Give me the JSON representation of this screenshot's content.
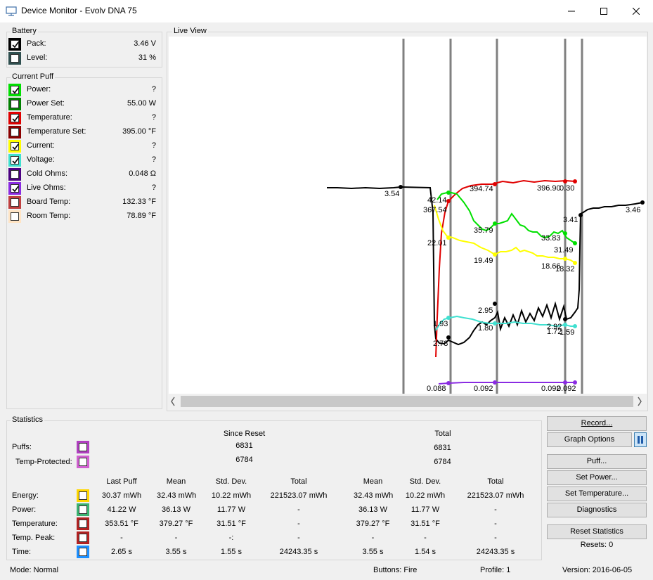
{
  "window": {
    "title": "Device Monitor - Evolv DNA 75",
    "minimize_icon": "minimize-icon",
    "maximize_icon": "maximize-icon",
    "close_icon": "close-icon"
  },
  "battery": {
    "label": "Battery",
    "rows": [
      {
        "name": "Pack:",
        "value": "3.46 V",
        "color": "#000000",
        "checked": true
      },
      {
        "name": "Level:",
        "value": "31 %",
        "color": "#2f4f4f",
        "checked": false
      }
    ]
  },
  "current_puff": {
    "label": "Current Puff",
    "rows": [
      {
        "name": "Power:",
        "value": "?",
        "color": "#00e000",
        "checked": true
      },
      {
        "name": "Power Set:",
        "value": "55.00 W",
        "color": "#008000",
        "checked": false
      },
      {
        "name": "Temperature:",
        "value": "?",
        "color": "#e00000",
        "checked": true
      },
      {
        "name": "Temperature Set:",
        "value": "395.00 °F",
        "color": "#8b0000",
        "checked": false
      },
      {
        "name": "Current:",
        "value": "?",
        "color": "#ffff00",
        "checked": true
      },
      {
        "name": "Voltage:",
        "value": "?",
        "color": "#40e0d0",
        "checked": true
      },
      {
        "name": "Cold Ohms:",
        "value": "0.048 Ω",
        "color": "#4b0082",
        "checked": false
      },
      {
        "name": "Live Ohms:",
        "value": "?",
        "color": "#8a2be2",
        "checked": true
      },
      {
        "name": "Board Temp:",
        "value": "132.33 °F",
        "color": "#c04040",
        "checked": false
      },
      {
        "name": "Room Temp:",
        "value": "78.89 °F",
        "color": "#ffe4c4",
        "checked": false
      }
    ]
  },
  "live_view": {
    "label": "Live View",
    "annotations": [
      {
        "text": "3.54"
      },
      {
        "text": "3.46"
      },
      {
        "text": "3.41"
      },
      {
        "text": "42.14"
      },
      {
        "text": "367.54"
      },
      {
        "text": "394.74"
      },
      {
        "text": "396.90"
      },
      {
        "text": "0.30"
      },
      {
        "text": "22.01"
      },
      {
        "text": "35.79"
      },
      {
        "text": "33.83"
      },
      {
        "text": "31.49"
      },
      {
        "text": "19.49"
      },
      {
        "text": "18.66"
      },
      {
        "text": "18.32"
      },
      {
        "text": "2.95"
      },
      {
        "text": "1.93"
      },
      {
        "text": "1.80"
      },
      {
        "text": "2.78"
      },
      {
        "text": "2.92"
      },
      {
        "text": "1.72"
      },
      {
        "text": "1.59"
      },
      {
        "text": "0.088"
      },
      {
        "text": "0.092"
      },
      {
        "text": "0.092"
      },
      {
        "text": "0.092"
      }
    ]
  },
  "statistics": {
    "label": "Statistics",
    "since_reset": "Since Reset",
    "total": "Total",
    "puffs_label": "Puffs:",
    "puffs_since": "6831",
    "puffs_total": "6831",
    "temp_protected_label": "Temp-Protected:",
    "temp_protected_since": "6784",
    "temp_protected_total": "6784",
    "headers": [
      "Last Puff",
      "Mean",
      "Std. Dev.",
      "Total",
      "Mean",
      "Std. Dev.",
      "Total"
    ],
    "rows": [
      {
        "label": "Energy:",
        "color": "#ffd700",
        "cells": [
          "30.37 mWh",
          "32.43 mWh",
          "10.22 mWh",
          "221523.07 mWh",
          "32.43 mWh",
          "10.22 mWh",
          "221523.07 mWh"
        ]
      },
      {
        "label": "Power:",
        "color": "#3cb371",
        "cells": [
          "41.22 W",
          "36.13 W",
          "11.77 W",
          "-",
          "36.13 W",
          "11.77 W",
          "-"
        ]
      },
      {
        "label": "Temperature:",
        "color": "#b22222",
        "cells": [
          "353.51 °F",
          "379.27 °F",
          "31.51 °F",
          "-",
          "379.27 °F",
          "31.51 °F",
          "-"
        ]
      },
      {
        "label": "Temp. Peak:",
        "color": "#b22222",
        "cells": [
          "-",
          "-",
          "-:",
          "-",
          "-",
          "-",
          "-"
        ]
      },
      {
        "label": "Time:",
        "color": "#1e90ff",
        "cells": [
          "2.65 s",
          "3.55 s",
          "1.55 s",
          "24243.35 s",
          "3.55 s",
          "1.54 s",
          "24243.35 s"
        ]
      }
    ]
  },
  "buttons": {
    "record": "Record...",
    "graph_options": "Graph Options",
    "puff": "Puff...",
    "set_power": "Set Power...",
    "set_temperature": "Set Temperature...",
    "diagnostics": "Diagnostics",
    "reset_statistics": "Reset Statistics",
    "resets": "Resets: 0"
  },
  "status_bar": {
    "mode": "Mode: Normal",
    "buttons": "Buttons: Fire",
    "profile": "Profile: 1",
    "version": "Version: 2016-06-05"
  }
}
